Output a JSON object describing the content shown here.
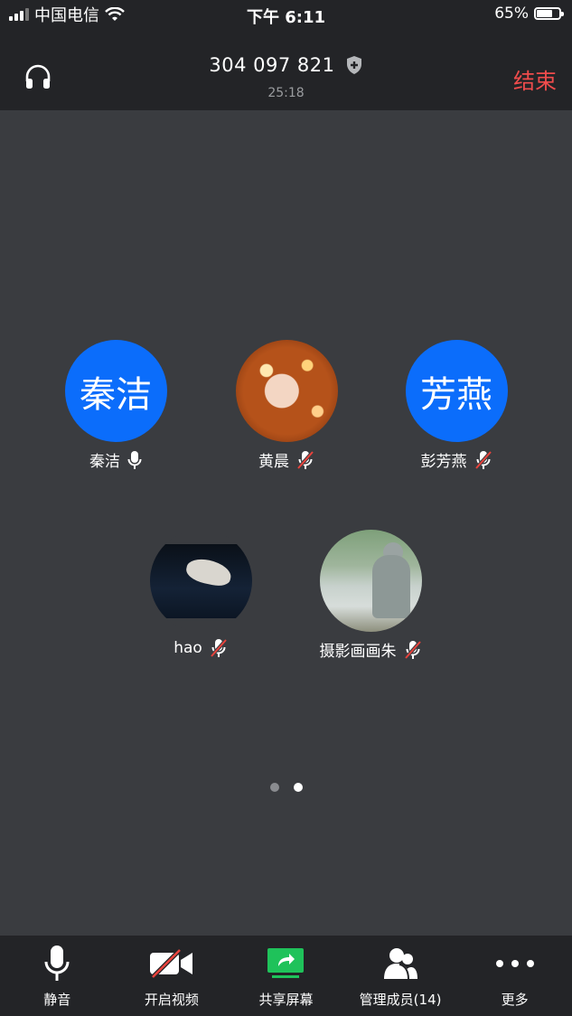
{
  "status_bar": {
    "carrier": "中国电信",
    "time": "下午 6:11",
    "battery": "65%"
  },
  "header": {
    "meeting_id": "304 097 821",
    "elapsed": "25:18",
    "end_label": "结束"
  },
  "participants": [
    {
      "name": "秦洁",
      "avatar_text": "秦洁",
      "mic": "on"
    },
    {
      "name": "黄晨",
      "avatar_text": "",
      "mic": "muted"
    },
    {
      "name": "彭芳燕",
      "avatar_text": "芳燕",
      "mic": "muted"
    },
    {
      "name": "hao",
      "avatar_text": "",
      "mic": "muted"
    },
    {
      "name": "摄影画画朱",
      "avatar_text": "",
      "mic": "muted"
    }
  ],
  "pagination": {
    "total": 2,
    "current": 2
  },
  "toolbar": {
    "mute_label": "静音",
    "video_label": "开启视频",
    "share_label": "共享屏幕",
    "members_label": "管理成员(14)",
    "more_label": "更多"
  },
  "colors": {
    "accent_blue": "#0b6dfb",
    "end_red": "#f04c4c",
    "share_green": "#1fc25a",
    "video_off_red": "#e8423c"
  }
}
